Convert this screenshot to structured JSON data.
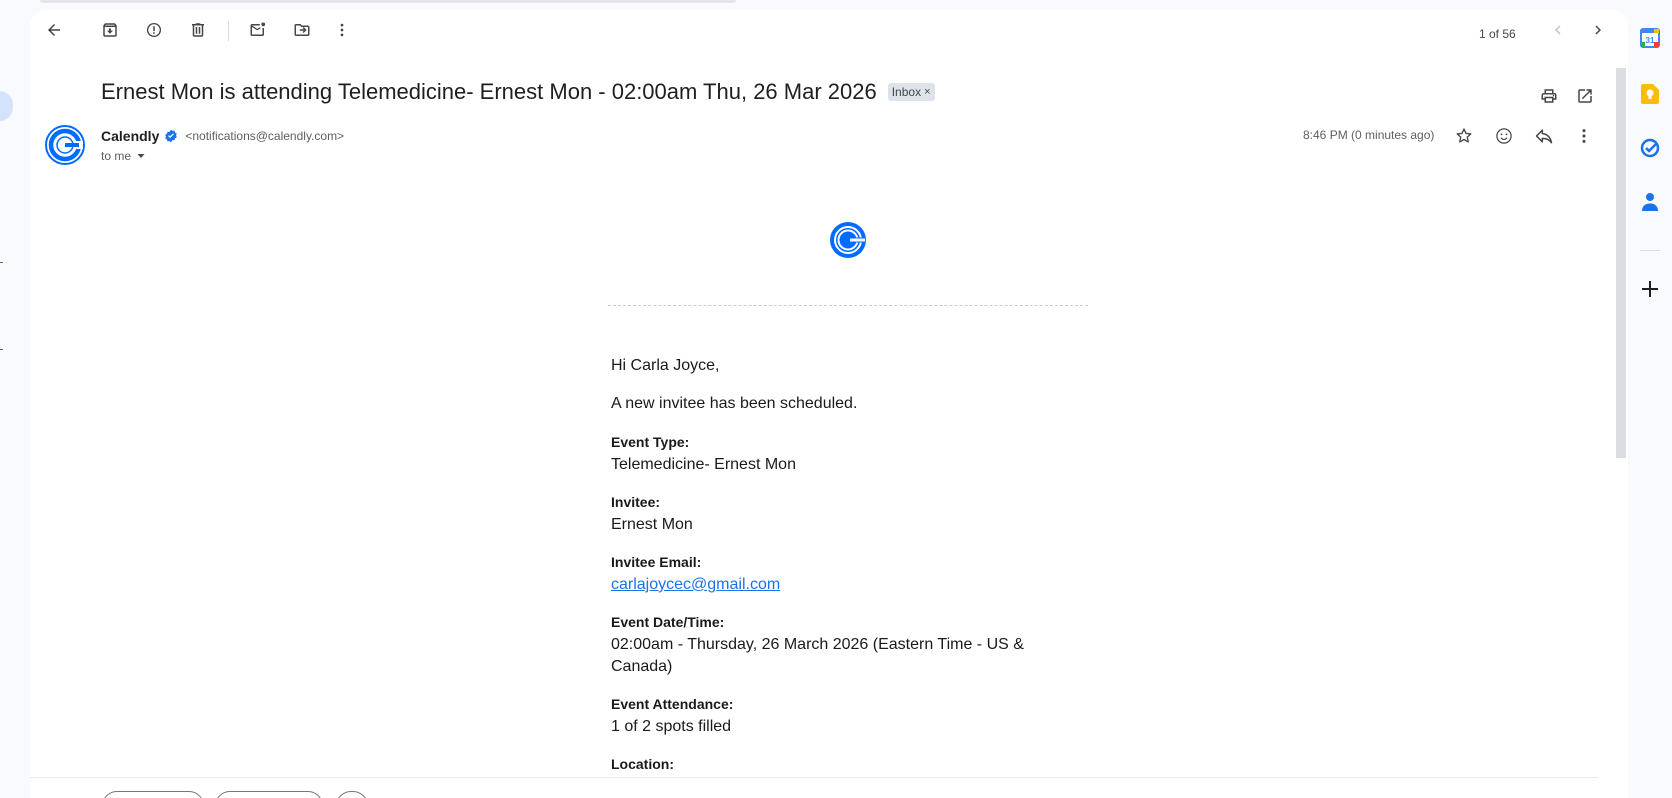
{
  "toolbar": {
    "back": "arrow-back-icon",
    "archive": "archive-icon",
    "spam": "report-spam-icon",
    "delete": "delete-icon",
    "mark_unread": "mark-unread-icon",
    "move_to": "move-to-icon",
    "more": "more-vert-icon",
    "pager": "1 of 56"
  },
  "email": {
    "subject": "Ernest Mon is attending Telemedicine- Ernest Mon - 02:00am Thu, 26 Mar 2026",
    "label_chip": "Inbox",
    "chip_close": "×",
    "sender_name": "Calendly",
    "sender_email": "<notifications@calendly.com>",
    "to": "to me",
    "time": "8:46 PM (0 minutes ago)"
  },
  "body": {
    "greeting": "Hi Carla Joyce,",
    "intro": "A new invitee has been scheduled.",
    "fields": [
      {
        "label": "Event Type:",
        "value": "Telemedicine- Ernest Mon"
      },
      {
        "label": "Invitee:",
        "value": "Ernest Mon"
      },
      {
        "label": "Invitee Email:",
        "value": "carlajoycec@gmail.com"
      },
      {
        "label": "Event Date/Time:",
        "value": "02:00am - Thursday, 26 March 2026 (Eastern Time - US & Canada)"
      },
      {
        "label": "Event Attendance:",
        "value": "1 of 2 spots filled"
      },
      {
        "label": "Location:",
        "value": ""
      }
    ]
  },
  "colors": {
    "accent": "#1a73e8",
    "calendly_blue": "#006bff",
    "chip_bg": "#dde3ea"
  },
  "right_rail": {
    "calendar_day": "31"
  }
}
